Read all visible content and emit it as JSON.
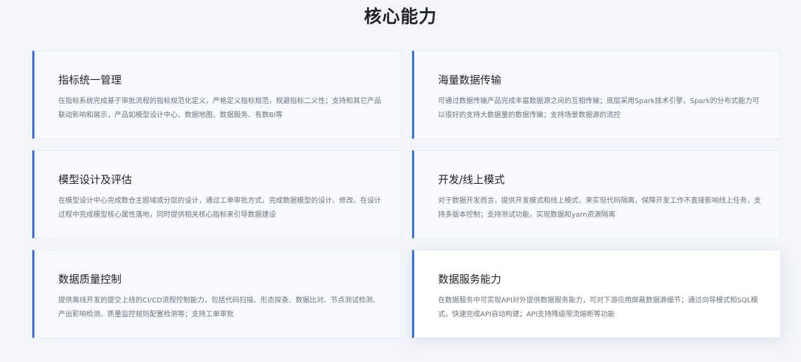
{
  "section": {
    "title": "核心能力"
  },
  "cards": [
    {
      "title": "指标统一管理",
      "desc": "在指标系统完成基于审批流程的指标规范化定义，严格定义指标规范，规避指标二义性；支持和其它产品联动影响和展示，产品如模型设计中心、数据地图、数据服务、有数BI等"
    },
    {
      "title": "海量数据传输",
      "desc": "可通过数据传输产品完成丰富数据源之间的互相传输；底层采用Spark技术引擎，Spark的分布式能力可以很好的支持大数据量的数据传输；支持场景数据源的流控"
    },
    {
      "title": "模型设计及评估",
      "desc": "在模型设计中心完成数仓主题域或分层的设计，通过工单审批方式，完成数据模型的设计、修改。在设计过程中完成模型核心属性落地，同时提供相关核心指标来引导数据建设"
    },
    {
      "title": "开发/线上模式",
      "desc": "对于数据开发而言，提供开发模式和线上模式，来实现代码隔离，保障开发工作不直接影响线上任务，支持多版本控制；支持测试功能，实现数据和yarn资源隔离"
    },
    {
      "title": "数据质量控制",
      "desc": "提供离线开发的提交上线的CI/CD流程控制能力，包括代码扫描、形态探查、数据比对、节点测试检测、产出影响检测、质量监控规则配置检测等；支持工单审批"
    },
    {
      "title": "数据服务能力",
      "desc": "在数据服务中可实现API对外提供数据服务能力，可对下游应用屏蔽数据源细节；通过向导模式和SQL模式，快速完成API自动构建；API支持降级限流熔断等功能"
    }
  ]
}
